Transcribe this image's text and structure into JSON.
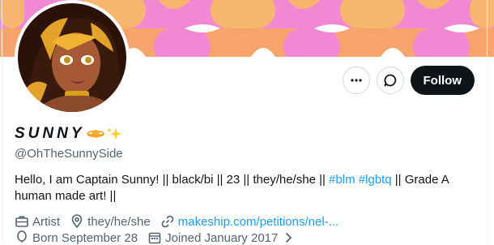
{
  "colors": {
    "follow_bg": "#0f1419",
    "link": "#1d9bf0",
    "muted": "#536471",
    "banner_pink": "#f07fd6",
    "banner_orange": "#f7b66f",
    "banner_white": "#ffffff"
  },
  "profile": {
    "display_name": "SUNNY",
    "name_emojis": [
      "planet-icon",
      "sparkles-icon"
    ],
    "handle": "@OhTheSunnySide",
    "bio": {
      "text_before": "Hello, I am Captain Sunny! || black/bi || 23 || they/he/she || ",
      "tag1": "#blm",
      "tag2": "#lgbtq",
      "text_after": " || Grade A human made art! ||"
    }
  },
  "actions": {
    "more_icon": "more-icon",
    "message_icon": "message-icon",
    "follow_label": "Follow"
  },
  "meta": {
    "category": "Artist",
    "location": "they/he/she",
    "website": "makeship.com/petitions/nel-...",
    "birthday": "Born September 28",
    "joined": "Joined January 2017"
  }
}
